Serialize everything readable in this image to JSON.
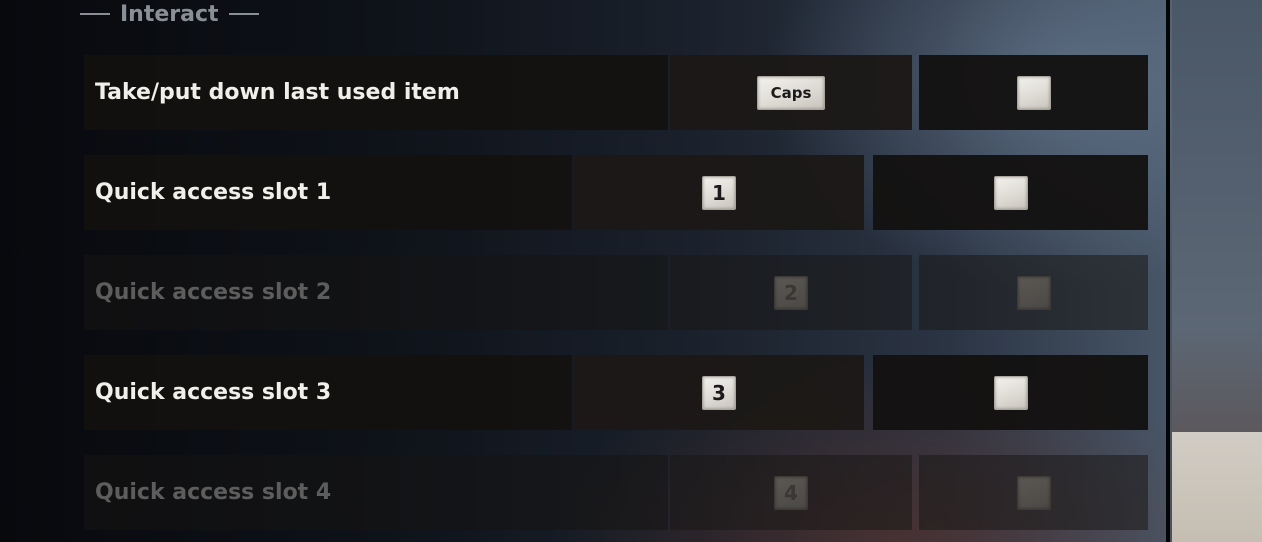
{
  "section": {
    "title": "Interact"
  },
  "rows": [
    {
      "label": "Take/put down last used item",
      "primary_key": "Caps",
      "secondary_key": "",
      "disabled": false
    },
    {
      "label": "Quick access slot 1",
      "primary_key": "1",
      "secondary_key": "",
      "disabled": false
    },
    {
      "label": "Quick access slot 2",
      "primary_key": "2",
      "secondary_key": "",
      "disabled": true
    },
    {
      "label": "Quick access slot 3",
      "primary_key": "3",
      "secondary_key": "",
      "disabled": false
    },
    {
      "label": "Quick access slot 4",
      "primary_key": "4",
      "secondary_key": "",
      "disabled": true
    }
  ],
  "colors": {
    "label_active": "#f1efea",
    "label_disabled": "#5d5d5d",
    "keycap": "#e8e5e0"
  }
}
